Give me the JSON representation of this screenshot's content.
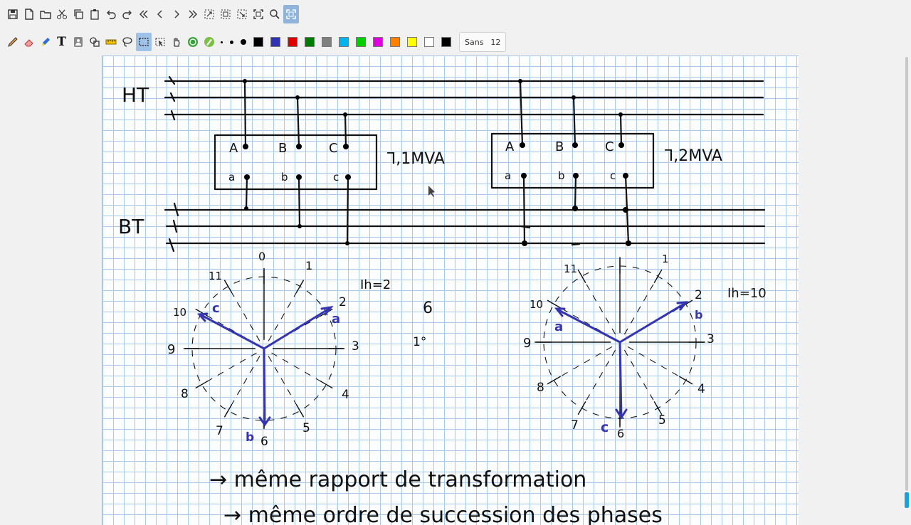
{
  "toolbar_top": {
    "buttons": [
      "save-icon",
      "new-page-icon",
      "open-icon",
      "cut-icon",
      "copy-icon",
      "paste-icon",
      "undo-icon",
      "redo-icon",
      "first-page-icon",
      "previous-page-icon",
      "next-page-icon",
      "last-page-icon",
      "zoom-region-icon",
      "zoom-fit-icon",
      "zoom-select-icon",
      "zoom-page-icon",
      "zoom-search-icon",
      "fullscreen-icon"
    ],
    "active": "fullscreen-icon"
  },
  "toolbar_tools": {
    "tools": [
      "pen-icon",
      "eraser-icon",
      "highlighter-icon",
      "text-icon",
      "image-icon",
      "shapes-icon",
      "ruler-icon",
      "lasso-icon",
      "select-rect-icon",
      "select-object-icon",
      "hand-icon",
      "play-icon",
      "pen-settings-icon"
    ],
    "active": "select-rect-icon",
    "text_tool_glyph": "T",
    "colors": [
      "#000000",
      "#3232b4",
      "#e00000",
      "#007d00",
      "#808080",
      "#00b4f0",
      "#00d000",
      "#e000e0",
      "#ff8000",
      "#ffff00",
      "#ffffff",
      "#000000"
    ],
    "font_name": "Sans",
    "font_size": "12"
  },
  "drawing": {
    "label_ht": "HT",
    "label_bt": "BT",
    "left_transformer": {
      "primary": [
        "A",
        "B",
        "C"
      ],
      "secondary": [
        "a",
        "b",
        "c"
      ],
      "rating": "⅂,1MVA"
    },
    "right_transformer": {
      "primary": [
        "A",
        "B",
        "C"
      ],
      "secondary": [
        "a",
        "b",
        "c"
      ],
      "rating": "⅂,2MVA"
    },
    "left_clock": {
      "hours": [
        "0",
        "1",
        "2",
        "3",
        "4",
        "5",
        "6",
        "7",
        "8",
        "9",
        "10",
        "11"
      ],
      "phasors": [
        "a",
        "b",
        "c"
      ],
      "index": "Ih=2"
    },
    "right_clock": {
      "hours": [
        "1",
        "2",
        "3",
        "4",
        "5",
        "6",
        "7",
        "8",
        "9",
        "10",
        "11"
      ],
      "phasors": [
        "a",
        "b",
        "c"
      ],
      "index": "Ih=10"
    },
    "middle_notes": [
      "6",
      "1°"
    ],
    "bottom_line1": "→ même rapport de transformation",
    "bottom_line2": "→ même ordre de succession des phases"
  }
}
